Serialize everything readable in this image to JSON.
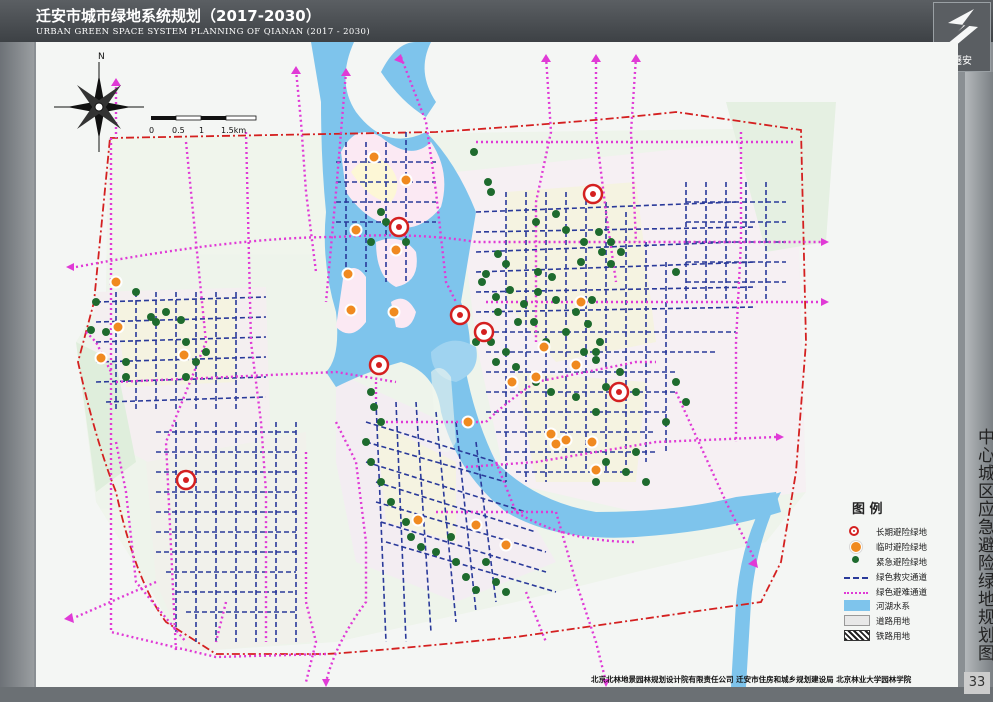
{
  "header": {
    "title": "迁安市城市绿地系统规划（2017-2030）",
    "subtitle": "URBAN GREEN SPACE SYSTEM PLANNING OF QIANAN (2017 - 2030)"
  },
  "logo": {
    "text": "遷安",
    "icon": "city-emblem-icon"
  },
  "side_title": "中心城区应急避险绿地规划图",
  "page_number": "33",
  "credits": "北京北林地景园林规划设计院有限责任公司 迁安市住房和城乡规划建设局 北京林业大学园林学院",
  "compass": {
    "north_label": "N",
    "icon": "north-arrow-icon"
  },
  "scale_bar": {
    "ticks": [
      "0",
      "0.5",
      "1",
      "1.5km"
    ]
  },
  "legend": {
    "title": "图 例",
    "items": [
      {
        "key": "long_term",
        "label": "长期避险绿地",
        "icon": "long-term-shelter-icon",
        "color": "#d42020"
      },
      {
        "key": "temporary",
        "label": "临时避险绿地",
        "icon": "temporary-shelter-icon",
        "color": "#f08a20"
      },
      {
        "key": "emergency",
        "label": "紧急避险绿地",
        "icon": "emergency-shelter-icon",
        "color": "#1e6b2e"
      },
      {
        "key": "rescue",
        "label": "绿色救灾通道",
        "icon": "rescue-route-line",
        "color": "#2a3a9a"
      },
      {
        "key": "evacuation",
        "label": "绿色避难通道",
        "icon": "evacuation-route-line",
        "color": "#e03ad6"
      },
      {
        "key": "water",
        "label": "河湖水系",
        "icon": "water-swatch",
        "color": "#7ec4ec"
      },
      {
        "key": "road",
        "label": "道路用地",
        "icon": "road-swatch",
        "color": "#e8e8e8"
      },
      {
        "key": "rail",
        "label": "铁路用地",
        "icon": "rail-swatch",
        "color": "#222222"
      }
    ]
  },
  "colors": {
    "header_bg": "#4a4e52",
    "water": "#7ec4ec",
    "boundary": "#d42020",
    "evacuation": "#e03ad6",
    "rescue": "#2a3a9a",
    "land_pink": "#f6e3ef",
    "land_yellow": "#f6f3d8",
    "land_green": "#d9ecd6"
  }
}
